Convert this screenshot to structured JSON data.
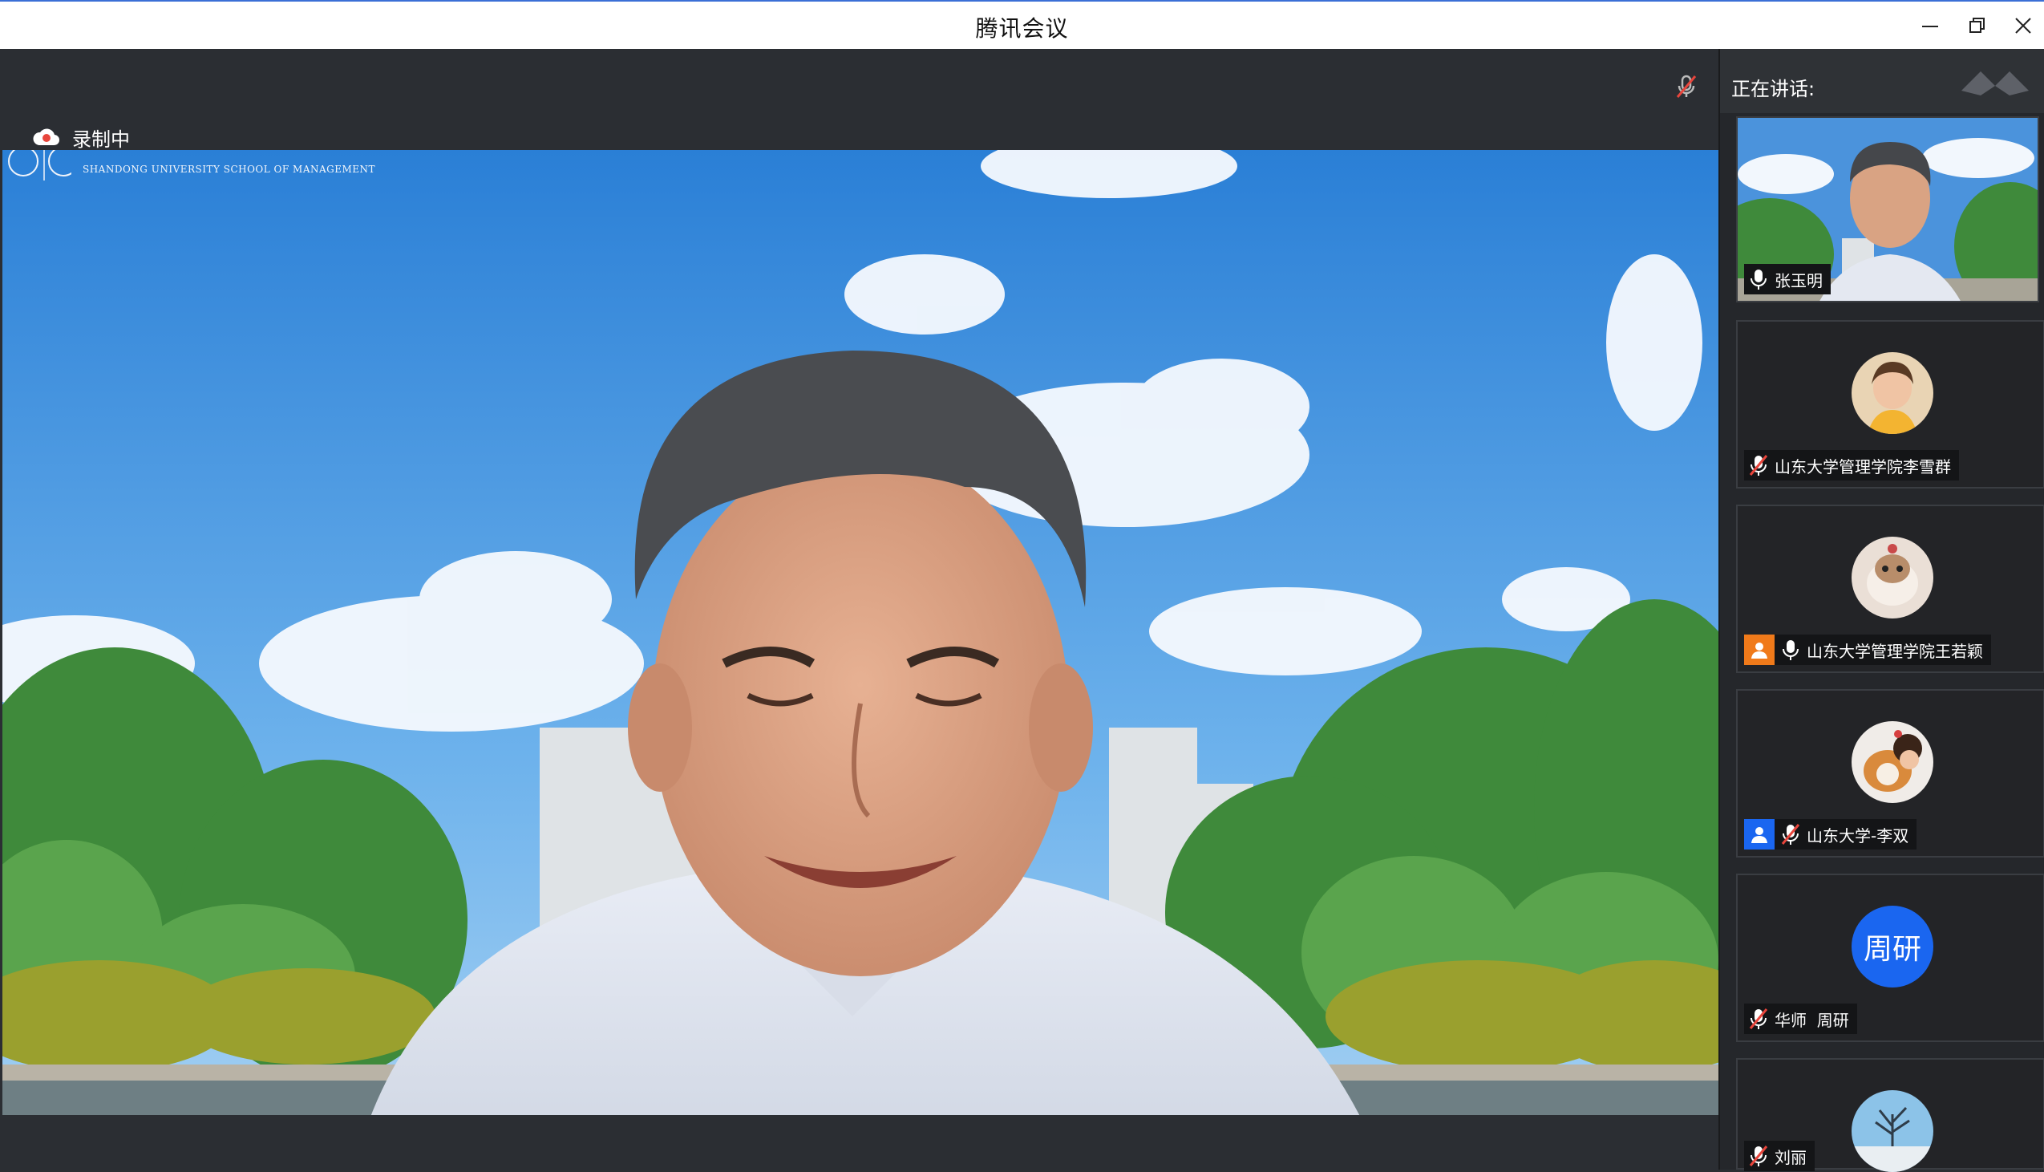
{
  "window": {
    "title": "腾讯会议"
  },
  "main": {
    "recording": {
      "label": "录制中"
    },
    "school_logo": {
      "subtitle": "SHANDONG UNIVERSITY SCHOOL OF MANAGEMENT"
    }
  },
  "panel": {
    "speaking_label": "正在讲话:",
    "speaker": {
      "name": "张玉明",
      "mic": "on"
    },
    "participants": [
      {
        "name": "山东大学管理学院李雪群",
        "mic": "muted",
        "badge": "none"
      },
      {
        "name": "山东大学管理学院王若颖",
        "mic": "on",
        "badge": "host"
      },
      {
        "name": "山东大学-李双",
        "mic": "muted",
        "badge": "cohost"
      },
      {
        "name": "华师  周研",
        "mic": "muted",
        "badge": "none",
        "avatar_text": "周研"
      },
      {
        "name": "刘丽",
        "mic": "muted",
        "badge": "none"
      }
    ]
  },
  "colors": {
    "accent": "#1a66f0",
    "host_badge": "#f07a1a",
    "cohost_badge": "#1a66f0"
  }
}
